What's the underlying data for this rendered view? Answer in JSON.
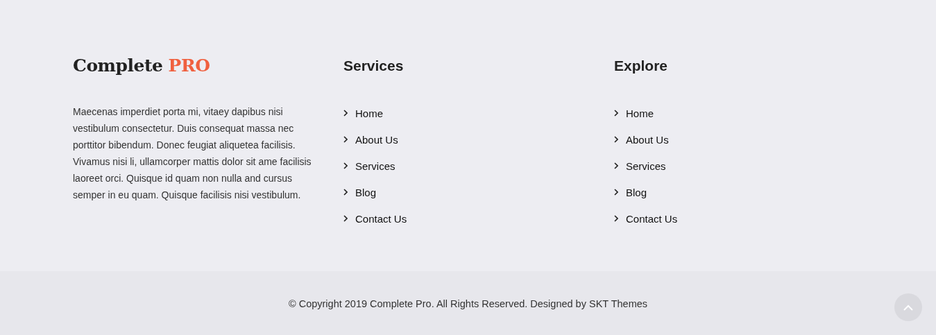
{
  "logo": {
    "name": "Complete",
    "accent": "PRO"
  },
  "about": "Maecenas imperdiet porta mi, vitaey dapibus nisi vestibulum consectetur. Duis consequat massa nec porttitor bibendum. Donec feugiat aliquetea facilisis. Vivamus nisi li, ullamcorper mattis dolor sit ame facilisis laoreet orci. Quisque id quam non nulla and cursus semper in eu quam. Quisque facilisis nisi vestibulum.",
  "columns": [
    {
      "title": "Services",
      "links": [
        "Home",
        "About Us",
        "Services",
        "Blog",
        "Contact Us"
      ]
    },
    {
      "title": "Explore",
      "links": [
        "Home",
        "About Us",
        "Services",
        "Blog",
        "Contact Us"
      ]
    }
  ],
  "copyright": "© Copyright 2019 Complete Pro. All Rights Reserved. Designed by SKT Themes"
}
